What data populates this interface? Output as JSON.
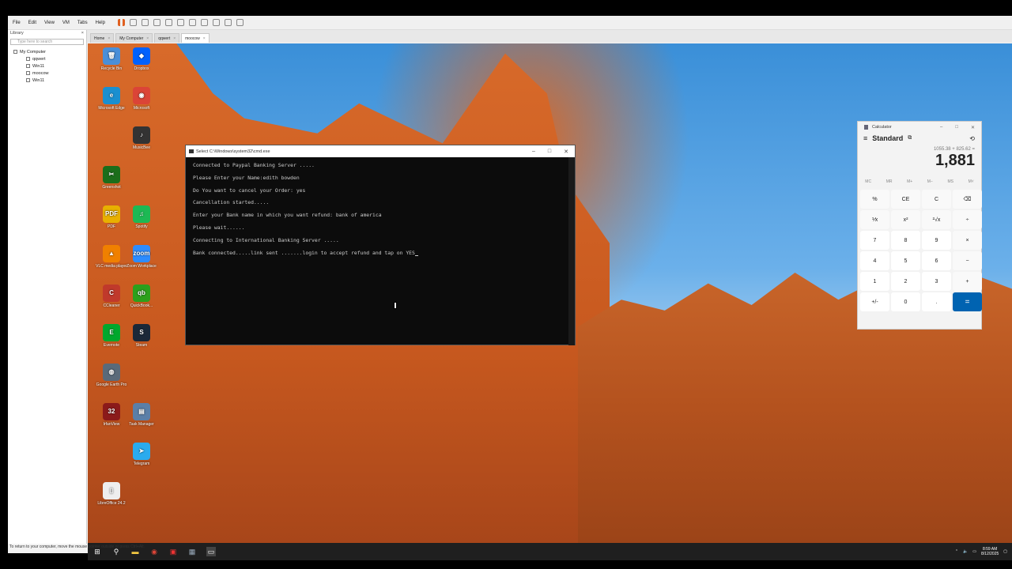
{
  "vm": {
    "menu": [
      "File",
      "Edit",
      "View",
      "VM",
      "Tabs",
      "Help"
    ],
    "library": {
      "title": "Library",
      "close": "×",
      "search_placeholder": "Type here to search",
      "tree": [
        {
          "label": "My Computer",
          "level": 0
        },
        {
          "label": "qqwert",
          "level": 1
        },
        {
          "label": "Win11",
          "level": 1
        },
        {
          "label": "moocow",
          "level": 1
        },
        {
          "label": "Win11",
          "level": 1
        }
      ]
    },
    "tabs": [
      {
        "label": "Home",
        "active": false
      },
      {
        "label": "My Computer",
        "active": false
      },
      {
        "label": "qqwert",
        "active": false
      },
      {
        "label": "moocow",
        "active": true
      }
    ],
    "status": "To return to your computer, move the mouse pointer outside or press Ctrl+Alt."
  },
  "desktop": {
    "icons": [
      {
        "label": "Recycle Bin",
        "color": "#4a8fd8",
        "glyph": "🗑"
      },
      {
        "label": "Dropbox",
        "color": "#0061fe",
        "glyph": "◆"
      },
      {
        "label": "Microsoft Edge",
        "color": "#1a8fd0",
        "glyph": "e"
      },
      {
        "label": "Microsoft",
        "color": "#db4437",
        "glyph": "◉"
      },
      {
        "label": "MusicBee",
        "color": "#333",
        "glyph": "♪"
      },
      {
        "label": "Greenshot",
        "color": "#1b6e1b",
        "glyph": "✂"
      },
      {
        "label": "PDF",
        "color": "#e8b000",
        "glyph": "PDF"
      },
      {
        "label": "Spotify",
        "color": "#1db954",
        "glyph": "♫"
      },
      {
        "label": "VLC media player",
        "color": "#f08000",
        "glyph": "▲"
      },
      {
        "label": "Zoom Workplace",
        "color": "#2d8cff",
        "glyph": "zoom"
      },
      {
        "label": "CCleaner",
        "color": "#c0392b",
        "glyph": "C"
      },
      {
        "label": "QuickBook...",
        "color": "#2ca01c",
        "glyph": "qb"
      },
      {
        "label": "Evernote",
        "color": "#00a82d",
        "glyph": "E"
      },
      {
        "label": "Steam",
        "color": "#1b2838",
        "glyph": "S"
      },
      {
        "label": "Google Earth Pro",
        "color": "#5a6a7a",
        "glyph": "◍"
      },
      {
        "label": "IrfanView",
        "color": "#8b1a1a",
        "glyph": "32"
      },
      {
        "label": "Task Manager",
        "color": "#5b7fa8",
        "glyph": "▤"
      },
      {
        "label": "Telegram",
        "color": "#2aabee",
        "glyph": "➤"
      },
      {
        "label": "LibreOffice 24.2",
        "color": "#eeeeee",
        "glyph": "▯"
      }
    ]
  },
  "cmd": {
    "title": "Select C:\\Windows\\system32\\cmd.exe",
    "lines": [
      "Connected to Paypal Banking Server .....",
      "Please Enter your Name:edith bowden",
      "Do You want to cancel your Order: yes",
      "Cancellation started.....",
      "Enter your Bank name in which you want refund: bank of america",
      "Please wait......",
      "Connecting to International Banking Server .....",
      "Bank connected.....link sent .......login to accept refund and tap on YES"
    ]
  },
  "calculator": {
    "title": "Calculator",
    "mode": "Standard",
    "expression": "1055.38 + 825.62 =",
    "display": "1,881",
    "memory": [
      "MC",
      "MR",
      "M+",
      "M−",
      "MS",
      "M˅"
    ],
    "keys": [
      "%",
      "CE",
      "C",
      "⌫",
      "⅟x",
      "x²",
      "²√x",
      "÷",
      "7",
      "8",
      "9",
      "×",
      "4",
      "5",
      "6",
      "−",
      "1",
      "2",
      "3",
      "+",
      "+/-",
      "0",
      ".",
      "="
    ]
  },
  "taskbar": {
    "time": "8:59 AM",
    "date": "8/12/2025"
  }
}
